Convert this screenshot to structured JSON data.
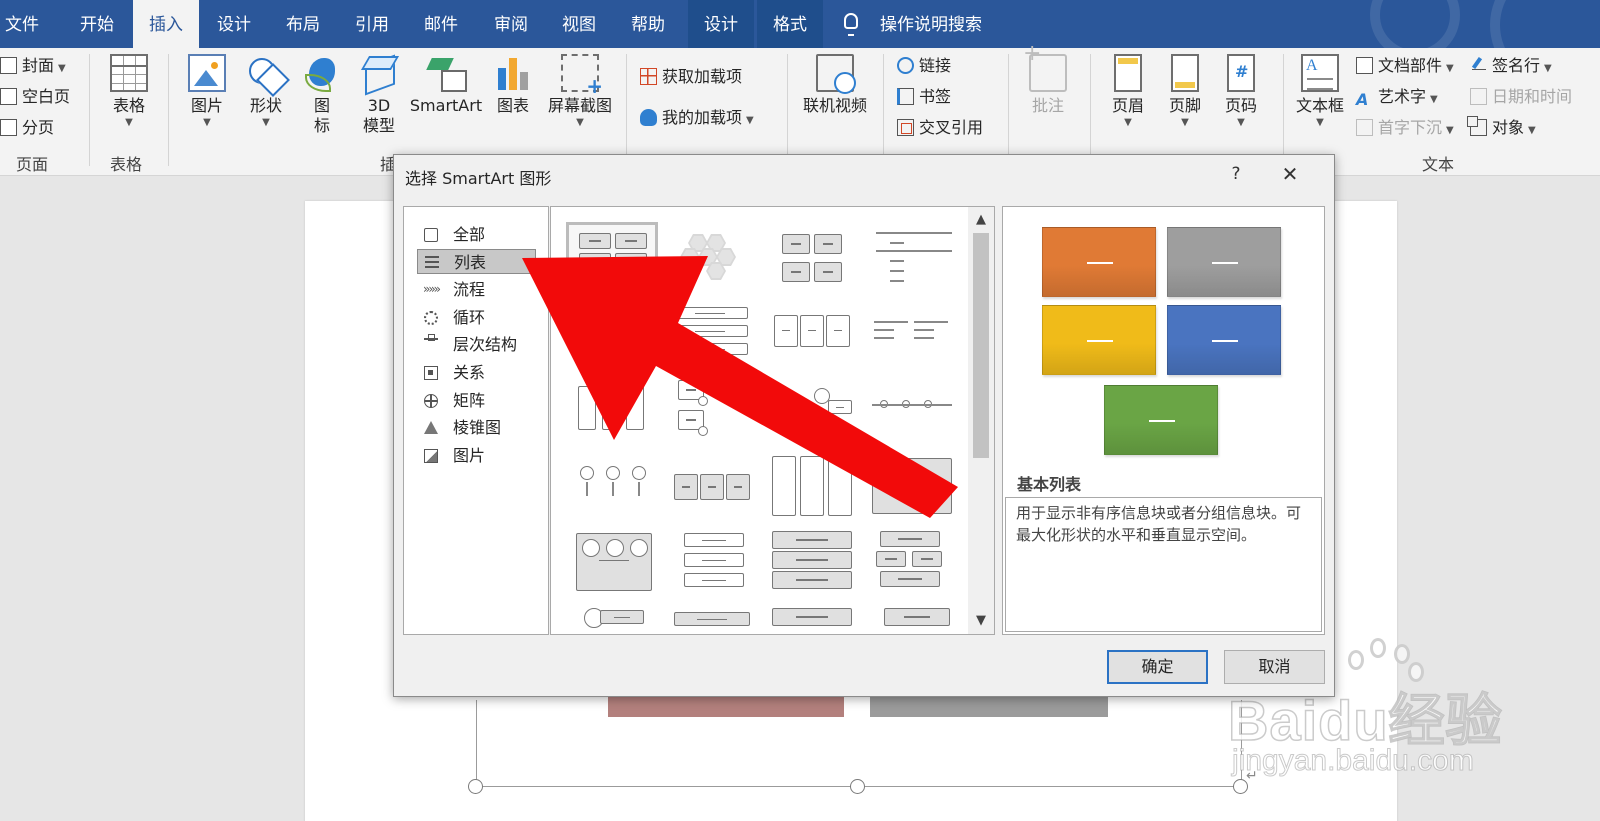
{
  "tabs": [
    "文件",
    "开始",
    "插入",
    "设计",
    "布局",
    "引用",
    "邮件",
    "审阅",
    "视图",
    "帮助",
    "设计",
    "格式"
  ],
  "search_label": "操作说明搜索",
  "ribbon": {
    "pages_group": {
      "cover": "封面",
      "blank": "空白页",
      "break": "分页",
      "label": "页面"
    },
    "table_group": {
      "table": "表格",
      "label": "表格"
    },
    "illustrations": {
      "picture": "图片",
      "shapes": "形状",
      "icons_l1": "图",
      "icons_l2": "标",
      "model_l1": "3D",
      "model_l2": "模型",
      "smartart": "SmartArt",
      "chart": "图表",
      "screenshot": "屏幕截图",
      "label_fragment": "插"
    },
    "addins": {
      "get": "获取加载项",
      "mine": "我的加载项"
    },
    "media": {
      "video": "联机视频"
    },
    "links": {
      "link": "链接",
      "bookmark": "书签",
      "crossref": "交叉引用"
    },
    "comments": {
      "comment": "批注"
    },
    "header_footer": {
      "header": "页眉",
      "footer": "页脚",
      "page_number": "页码"
    },
    "text": {
      "textbox": "文本框",
      "quickparts": "文档部件",
      "wordart": "艺术字",
      "dropcap": "首字下沉",
      "signature": "签名行",
      "datetime": "日期和时间",
      "object": "对象",
      "label": "文本"
    }
  },
  "dialog": {
    "title": "选择 SmartArt 图形",
    "help": "?",
    "close": "✕",
    "categories": [
      "全部",
      "列表",
      "流程",
      "循环",
      "层次结构",
      "关系",
      "矩阵",
      "棱锥图",
      "图片"
    ],
    "selected_category": "列表",
    "preview_title": "基本列表",
    "preview_desc": "用于显示非有序信息块或者分组信息块。可最大化形状的水平和垂直显示空间。",
    "ok": "确定",
    "cancel": "取消"
  },
  "colors": {
    "preview_orange": "#e07a35",
    "preview_gray": "#9e9e9e",
    "preview_yellow": "#f0bb19",
    "preview_blue": "#4a74c0",
    "preview_green": "#6aa545",
    "annotation_red": "#f20a0a",
    "accent": "#2b579a"
  },
  "watermark": {
    "logo": "Baidu经验",
    "url": "jingyan.baidu.com"
  }
}
